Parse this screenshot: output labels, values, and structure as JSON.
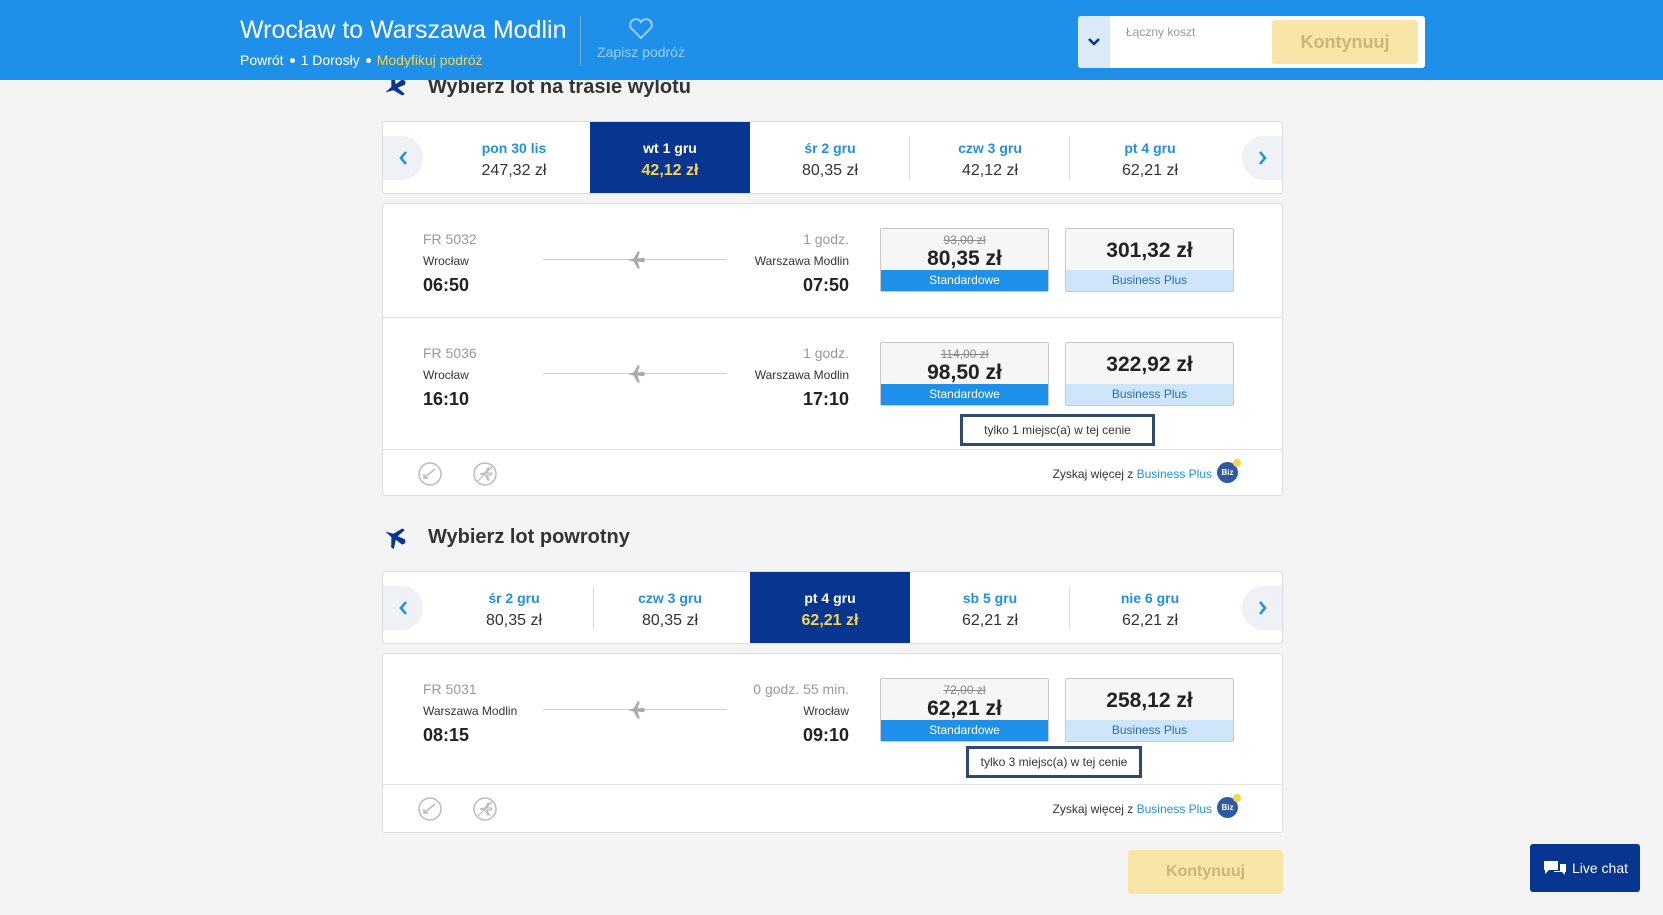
{
  "header": {
    "title": "Wrocław to Warszawa Modlin",
    "trip_type": "Powrót",
    "passengers": "1 Dorosły",
    "modify": "Modyfikuj podróż",
    "save_trip": "Zapisz podróż",
    "total_cost_label": "Łączny koszt",
    "continue": "Kontynuuj"
  },
  "outbound": {
    "title": "Wybierz lot na trasie wylotu",
    "dates": [
      {
        "date": "pon 30 lis",
        "price": "247,32 zł"
      },
      {
        "date": "wt 1 gru",
        "price": "42,12 zł"
      },
      {
        "date": "śr 2 gru",
        "price": "80,35 zł"
      },
      {
        "date": "czw 3 gru",
        "price": "42,12 zł"
      },
      {
        "date": "pt 4 gru",
        "price": "62,21 zł"
      }
    ],
    "flights": [
      {
        "number": "FR 5032",
        "from": "Wrocław",
        "to": "Warszawa Modlin",
        "dep": "06:50",
        "arr": "07:50",
        "duration": "1 godz.",
        "std_old": "93,00 zł",
        "std_price": "80,35 zł",
        "std_label": "Standardowe",
        "biz_price": "301,32 zł",
        "biz_label": "Business Plus"
      },
      {
        "number": "FR 5036",
        "from": "Wrocław",
        "to": "Warszawa Modlin",
        "dep": "16:10",
        "arr": "17:10",
        "duration": "1 godz.",
        "std_old": "114,00 zł",
        "std_price": "98,50 zł",
        "std_label": "Standardowe",
        "biz_price": "322,92 zł",
        "biz_label": "Business Plus",
        "seats": "tylko 1 miejsc(a) w tej cenie"
      }
    ],
    "promo_text": "Zyskaj więcej z ",
    "promo_link": "Business Plus",
    "biz_badge": "Biz"
  },
  "inbound": {
    "title": "Wybierz lot powrotny",
    "dates": [
      {
        "date": "śr 2 gru",
        "price": "80,35 zł"
      },
      {
        "date": "czw 3 gru",
        "price": "80,35 zł"
      },
      {
        "date": "pt 4 gru",
        "price": "62,21 zł"
      },
      {
        "date": "sb 5 gru",
        "price": "62,21 zł"
      },
      {
        "date": "nie 6 gru",
        "price": "62,21 zł"
      }
    ],
    "flights": [
      {
        "number": "FR 5031",
        "from": "Warszawa Modlin",
        "to": "Wrocław",
        "dep": "08:15",
        "arr": "09:10",
        "duration": "0 godz. 55 min.",
        "std_old": "72,00 zł",
        "std_price": "62,21 zł",
        "std_label": "Standardowe",
        "biz_price": "258,12 zł",
        "biz_label": "Business Plus",
        "seats": "tylko 3 miejsc(a) w tej cenie"
      }
    ],
    "promo_text": "Zyskaj więcej z ",
    "promo_link": "Business Plus",
    "biz_badge": "Biz"
  },
  "footer": {
    "continue": "Kontynuuj",
    "live_chat": "Live chat"
  },
  "colors": {
    "brand_blue": "#1e90e9",
    "navy": "#073590",
    "yellow": "#f8d44a"
  }
}
